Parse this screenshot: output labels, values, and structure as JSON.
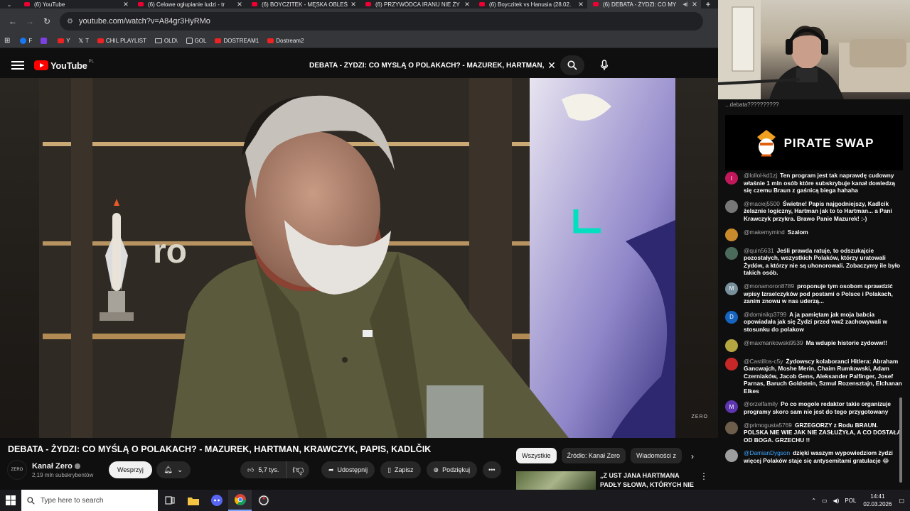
{
  "browser": {
    "tabs": [
      {
        "title": "(6) YouTube",
        "active": false
      },
      {
        "title": "(6) Celowe ogłupianie ludzi - tr",
        "active": false
      },
      {
        "title": "(6) BOYCZITEK - MĘSKA OBLEŚ",
        "active": false
      },
      {
        "title": "(6) PRZYWÓDCA IRANU NIE ŻY",
        "active": false
      },
      {
        "title": "(6) Boyczitek vs Hanusia (28.02.",
        "active": false
      },
      {
        "title": "(6) DEBATA - ŻYDZI: CO MY",
        "active": true
      }
    ],
    "new_tab": "+",
    "url": "youtube.com/watch?v=A84gr3HyRMo",
    "bookmarks": [
      {
        "label": "F",
        "icon": "facebook-icon"
      },
      {
        "label": "",
        "icon": "twitch-icon"
      },
      {
        "label": "Y",
        "icon": "youtube-icon"
      },
      {
        "label": "T",
        "icon": "x-icon"
      },
      {
        "label": "CHIL PLAYLIST",
        "icon": "youtube-icon"
      },
      {
        "label": "OLD\\",
        "icon": "folder-icon"
      },
      {
        "label": "GOL",
        "icon": "gol-icon"
      },
      {
        "label": "DOSTREAM1",
        "icon": "youtube-icon"
      },
      {
        "label": "Dostream2",
        "icon": "youtube-icon"
      }
    ]
  },
  "youtube": {
    "logo": "YouTube",
    "region": "PL",
    "search_query": "DEBATA - ŻYDZI: CO MYŚLĄ O POLAKACH? - MAZUREK, HARTMAN, KRAWCZYK, PAPIS, KADLČIK"
  },
  "video": {
    "watermark": "ZERO",
    "title": "DEBATA - ŻYDZI: CO MYŚLĄ O POLAKACH? - MAZUREK, HARTMAN, KRAWCZYK, PAPIS, KADLČIK",
    "channel_avatar": "ZERO",
    "channel": "Kanał Zero",
    "subscribers": "2,19 mln subskrybentów",
    "support_label": "Wesprzyj",
    "likes": "5,7 tys.",
    "share_label": "Udostępnij",
    "save_label": "Zapisz",
    "thanks_label": "Podziękuj"
  },
  "chips": [
    "Wszystkie",
    "Źródło: Kanał Zero",
    "Wiadomości z"
  ],
  "recommended": {
    "title": "„Z UST JANA HARTMANA PADŁY SŁOWA, KTÓRYCH NIE ..."
  },
  "chat": {
    "top_message": "...debata??????????",
    "sponsor": "PIRATE SWAP",
    "messages": [
      {
        "avatar": "I",
        "color": "#c2185b",
        "user": "@lollol-kd1zj",
        "text": "Ten program jest tak naprawdę cudowny właśnie 1 mln osób które subskrybuje kanał dowiedzą się czemu Braun z gaśnicą biega hahaha"
      },
      {
        "avatar": "",
        "color": "#777777",
        "user": "@maciej5500",
        "text": "Świetne! Papis najgodniejszy, Kadlcik żelaznie logiczny, Hartman jak to to Hartman... a Pani Krawczyk przykra. Brawo Panie Mazurek! :-)"
      },
      {
        "avatar": "",
        "color": "#c98a2c",
        "user": "@makemymind",
        "text": "Szalom"
      },
      {
        "avatar": "",
        "color": "#4a6b5c",
        "user": "@quin5631",
        "text": "Jeśli prawda ratuje, to odszukajcie pozostałych, wszystkich Polaków, którzy uratowali Żydów, a którzy nie są uhonorowali. Zobaczymy ile było takich osób."
      },
      {
        "avatar": "M",
        "color": "#78909c",
        "user": "@monamoron8789",
        "text": "proponuje tym osobom sprawdzić wpisy Izraelczyków pod postami o Polsce i Polakach, zanim znowu w nas uderzą..."
      },
      {
        "avatar": "D",
        "color": "#1565c0",
        "user": "@dominikp3799",
        "text": "A ja pamiętam jak moja babcia opowiadała jak się Żydzi przed ww2 zachowywali w stosunku do polakow"
      },
      {
        "avatar": "",
        "color": "#b5a642",
        "user": "@maxmankowski9539",
        "text": "Ma wdupie historie zydoww!!"
      },
      {
        "avatar": "",
        "color": "#c62828",
        "user": "@Castillos-c5y",
        "text": "Żydowscy kolaboranci Hitlera: Abraham Gancwajch, Moshe Merin, Chaim Rumkowski, Adam Czerniaków, Jacob Gens, Aleksander Palfinger, Josef Parnas, Baruch Goldstein, Szmul Rozensztajn, Elchanan Elkes"
      },
      {
        "avatar": "M",
        "color": "#5e35b1",
        "user": "@orzelfamily",
        "text": "Po co mogole redaktor takie organizuje programy skoro sam nie jest do tego przygotowany"
      },
      {
        "avatar": "",
        "color": "#6d5d4b",
        "user": "@primogusta5769",
        "text": "GRZEGORZY z Rodu BRAUN. POLSKA NIE WIE JAK NIE ZASŁUŻYŁA, A CO DOSTAŁA OD BOGA. GRZECHU !!"
      },
      {
        "avatar": "",
        "color": "#9e9e9e",
        "user": "@DamianDygson",
        "text": "dzięki waszym wypowiedziom żydzi więcej Polaków staje się antysemitami gratulacje 😂"
      }
    ]
  },
  "taskbar": {
    "search_placeholder": "Type here to search",
    "lang": "POL",
    "time": "14:41",
    "date": "02.03.2026"
  }
}
